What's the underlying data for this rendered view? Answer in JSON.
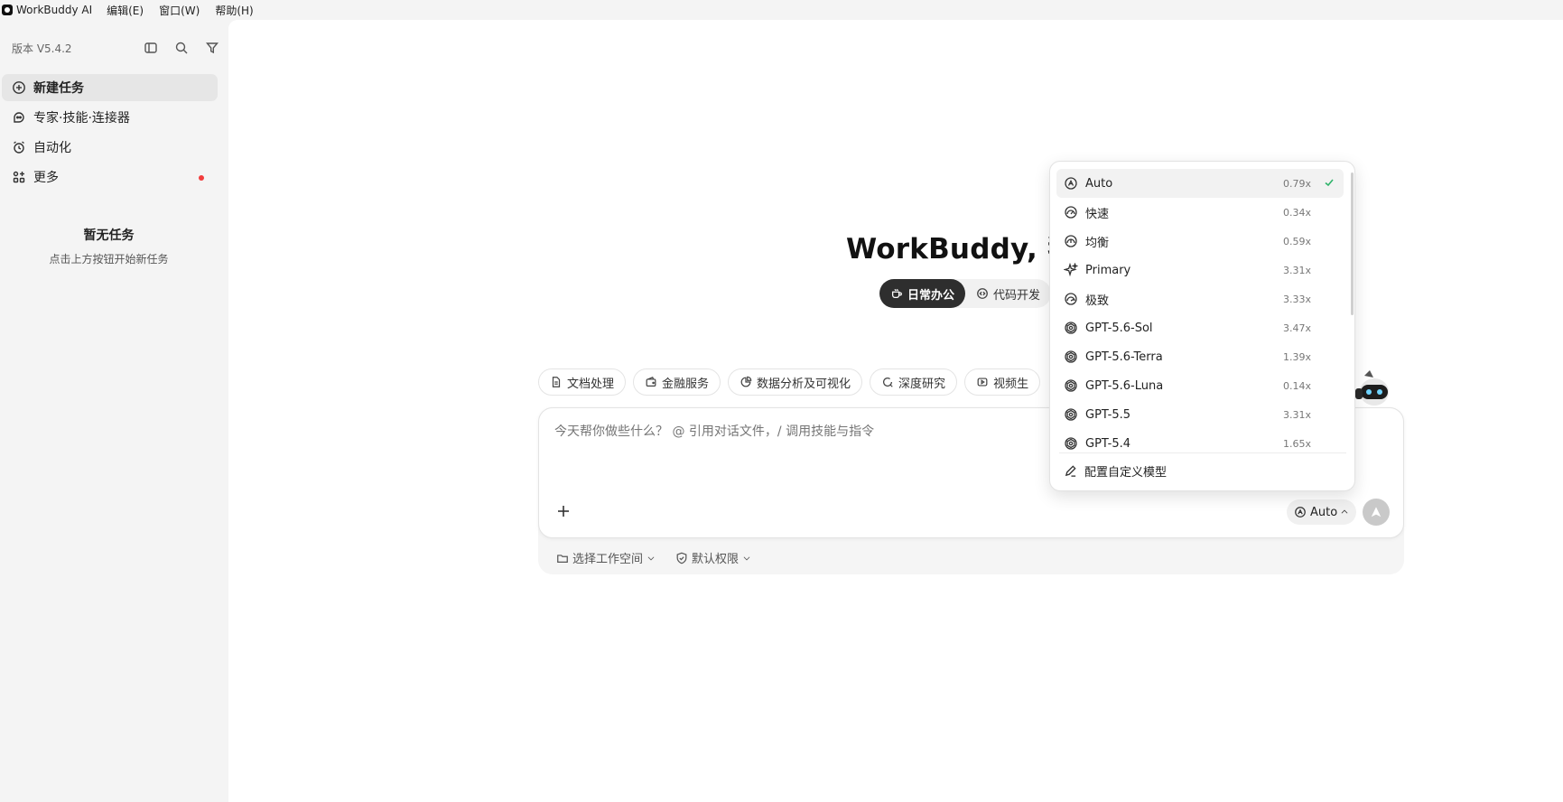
{
  "menubar": {
    "app_name": "WorkBuddy AI",
    "items": [
      "编辑(E)",
      "窗口(W)",
      "帮助(H)"
    ]
  },
  "sidebar": {
    "version": "版本 V5.4.2",
    "nav": [
      {
        "label": "新建任务",
        "icon": "plus-circle-icon",
        "active": true
      },
      {
        "label": "专家·技能·连接器",
        "icon": "expert-icon",
        "active": false
      },
      {
        "label": "自动化",
        "icon": "alarm-clock-icon",
        "active": false
      },
      {
        "label": "更多",
        "icon": "apps-icon",
        "active": false,
        "badge": true
      }
    ],
    "empty_title": "暂无任务",
    "empty_subtitle": "点击上方按钮开始新任务"
  },
  "main": {
    "hero_title": "WorkBuddy, 我帮你",
    "mode_tabs": [
      {
        "label": "日常办公",
        "icon": "coffee-icon",
        "active": true
      },
      {
        "label": "代码开发",
        "icon": "code-icon",
        "active": false
      }
    ],
    "chips": [
      {
        "label": "文档处理",
        "icon": "document-icon"
      },
      {
        "label": "金融服务",
        "icon": "wallet-icon"
      },
      {
        "label": "数据分析及可视化",
        "icon": "pie-chart-icon"
      },
      {
        "label": "深度研究",
        "icon": "research-icon"
      },
      {
        "label": "视频生",
        "icon": "video-icon"
      }
    ],
    "composer": {
      "placeholder": "今天帮你做些什么？ @ 引用对话文件，/ 调用技能与指令",
      "model_label": "Auto"
    },
    "footer": {
      "workspace": "选择工作空间",
      "permission": "默认权限"
    }
  },
  "dropdown": {
    "items": [
      {
        "name": "Auto",
        "mult": "0.79x",
        "icon": "auto-icon",
        "selected": true
      },
      {
        "name": "快速",
        "mult": "0.34x",
        "icon": "speed-icon"
      },
      {
        "name": "均衡",
        "mult": "0.59x",
        "icon": "speed-icon"
      },
      {
        "name": "Primary",
        "mult": "3.31x",
        "icon": "sparkle-icon"
      },
      {
        "name": "极致",
        "mult": "3.33x",
        "icon": "speed-icon"
      },
      {
        "name": "GPT-5.6-Sol",
        "mult": "3.47x",
        "icon": "openai-icon"
      },
      {
        "name": "GPT-5.6-Terra",
        "mult": "1.39x",
        "icon": "openai-icon"
      },
      {
        "name": "GPT-5.6-Luna",
        "mult": "0.14x",
        "icon": "openai-icon"
      },
      {
        "name": "GPT-5.5",
        "mult": "3.31x",
        "icon": "openai-icon"
      },
      {
        "name": "GPT-5.4",
        "mult": "1.65x",
        "icon": "openai-icon"
      }
    ],
    "config_label": "配置自定义模型"
  }
}
